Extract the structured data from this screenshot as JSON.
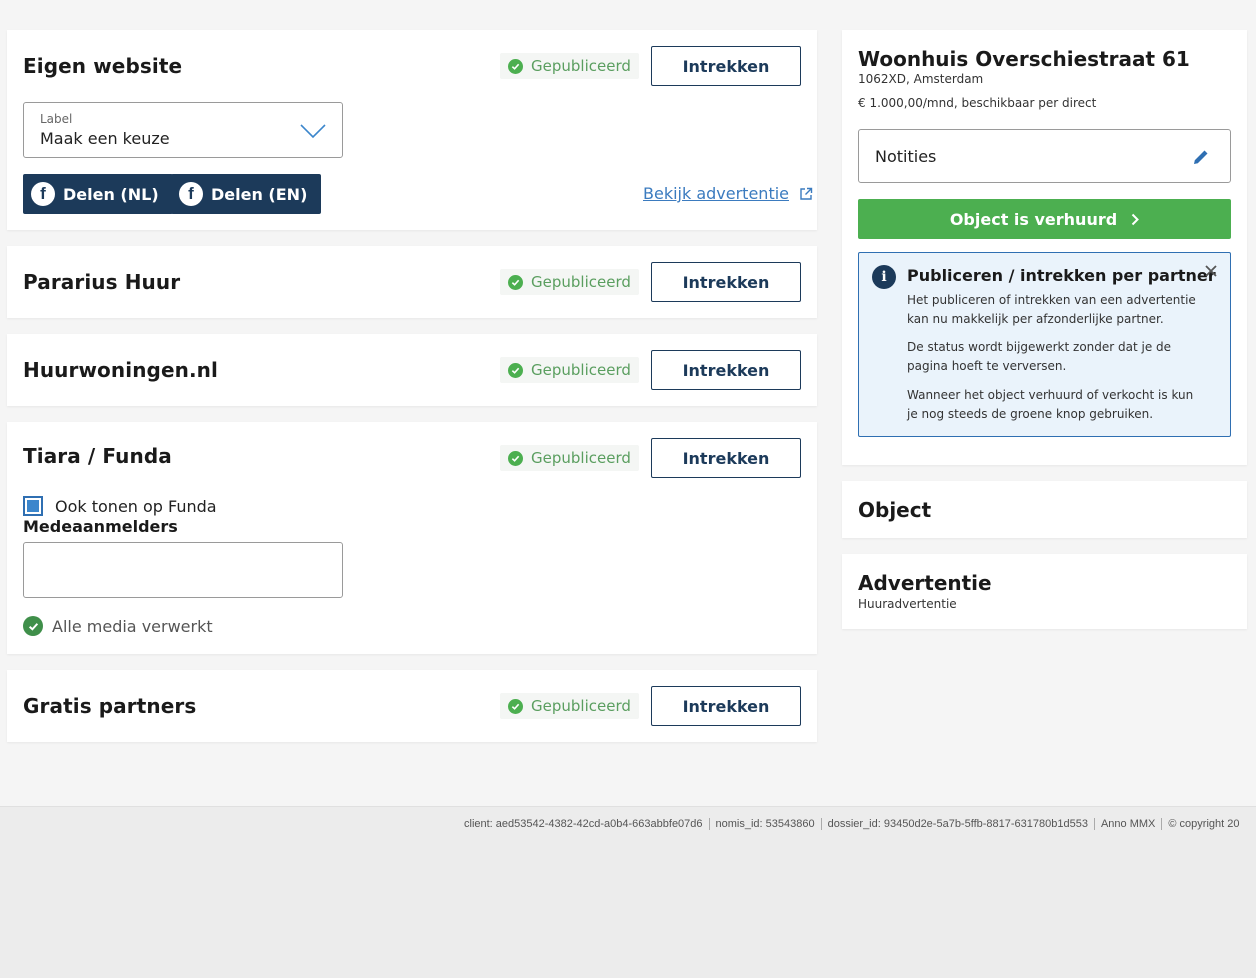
{
  "channels": {
    "eigen_website": {
      "title": "Eigen website",
      "status": "Gepubliceerd",
      "action": "Intrekken",
      "label_select": {
        "label": "Label",
        "value": "Maak een keuze"
      },
      "share_nl": "Delen (NL)",
      "share_en": "Delen (EN)",
      "view_link": "Bekijk advertentie"
    },
    "pararius": {
      "title": "Pararius Huur",
      "status": "Gepubliceerd",
      "action": "Intrekken"
    },
    "huurwoningen": {
      "title": "Huurwoningen.nl",
      "status": "Gepubliceerd",
      "action": "Intrekken"
    },
    "tiara": {
      "title": "Tiara / Funda",
      "status": "Gepubliceerd",
      "action": "Intrekken",
      "checkbox_label": "Ook tonen op Funda",
      "co_agents_label": "Medeaanmelders",
      "co_agents_value": "",
      "media_status": "Alle media verwerkt"
    },
    "gratis": {
      "title": "Gratis partners",
      "status": "Gepubliceerd",
      "action": "Intrekken"
    }
  },
  "property": {
    "title": "Woonhuis Overschiestraat 61",
    "address": "1062XD, Amsterdam",
    "price": "€ 1.000,00/mnd, beschikbaar per direct",
    "notes_label": "Notities",
    "rented_button": "Object is verhuurd"
  },
  "info": {
    "title": "Publiceren / intrekken per partner",
    "p1": "Het publiceren of intrekken van een advertentie kan nu makkelijk per afzonderlijke partner.",
    "p2": "De status wordt bijgewerkt zonder dat je de pagina hoeft te verversen.",
    "p3": "Wanneer het object verhuurd of verkocht is kun je nog steeds de groene knop gebruiken."
  },
  "object_section": {
    "title": "Object"
  },
  "advert_section": {
    "title": "Advertentie",
    "subtitle": "Huuradvertentie"
  },
  "footer": {
    "client": "client: aed53542-4382-42cd-a0b4-663abbfe07d6",
    "nomis": "nomis_id: 53543860",
    "dossier": "dossier_id: 93450d2e-5a7b-5ffb-8817-631780b1d553",
    "anno": "Anno MMX",
    "copyright": "© copyright 20"
  },
  "colors": {
    "navy": "#1c3a5a",
    "green": "#4caf50",
    "link": "#3b7bbf",
    "info_bg": "#eaf3fb"
  }
}
